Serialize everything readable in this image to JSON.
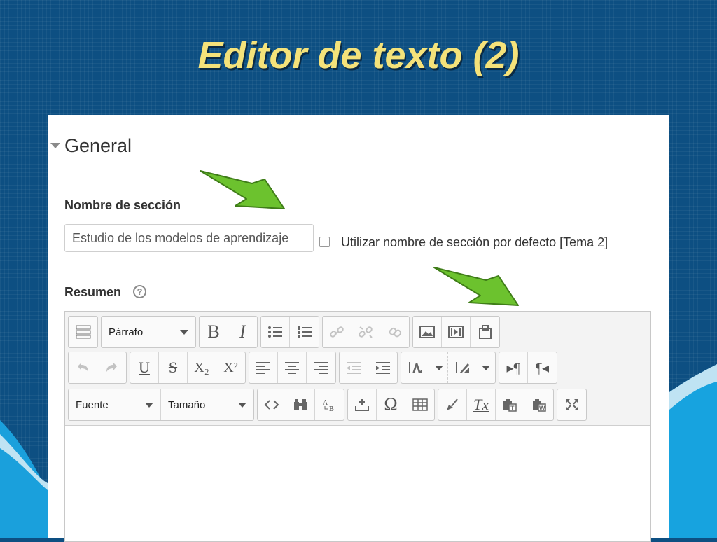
{
  "slide": {
    "title": "Editor de texto (2)"
  },
  "form": {
    "section_legend": "General",
    "name_label": "Nombre de sección",
    "name_value": "Estudio de los modelos de aprendizaje",
    "default_name_label": "Utilizar nombre de sección por defecto [Tema 2]",
    "summary_label": "Resumen",
    "help_glyph": "?"
  },
  "toolbar": {
    "paragraph_select": "Párrafo",
    "font_select": "Fuente",
    "size_select": "Tamaño",
    "bold": "B",
    "italic": "I",
    "underline": "U",
    "strike": "S",
    "subscript": "X₂",
    "superscript": "X²",
    "special_char": "Ω",
    "clear_format": "Tx",
    "ltr": "▸¶",
    "rtl": "¶◂"
  },
  "colors": {
    "slide_bg": "#0d4f82",
    "title": "#f4e27a",
    "arrow_green": "#6cc22e"
  }
}
